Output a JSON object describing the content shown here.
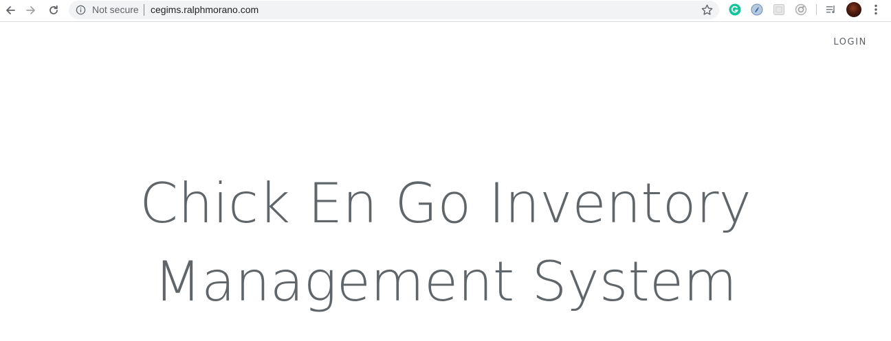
{
  "browser": {
    "security_label": "Not secure",
    "url": "cegims.ralphmorano.com",
    "icons": {
      "back": "back-arrow-icon",
      "forward": "forward-arrow-icon",
      "reload": "reload-icon",
      "info": "info-icon",
      "bookmark": "star-icon",
      "extensions": [
        "grammarly-icon",
        "extension-blue-icon",
        "extension-gray-icon",
        "extension-camera-icon",
        "media-queue-icon"
      ],
      "menu": "kebab-menu-icon"
    },
    "colors": {
      "grammarly": "#15c39a",
      "omnibox_bg": "#f1f3f4"
    }
  },
  "nav": {
    "login_label": "LOGIN"
  },
  "hero": {
    "title_line1": "Chick En Go Inventory",
    "title_line2": "Management System",
    "color": "#5f6569"
  }
}
